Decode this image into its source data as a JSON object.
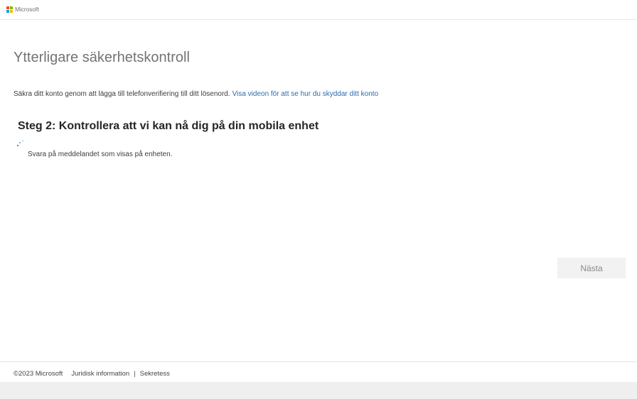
{
  "header": {
    "logo_text": "Microsoft",
    "logo_colors": [
      "#f25022",
      "#7fba00",
      "#00a4ef",
      "#ffb900"
    ]
  },
  "page": {
    "title": "Ytterligare säkerhetskontroll",
    "intro_text": "Säkra ditt konto genom att lägga till telefonverifiering till ditt lösenord.",
    "intro_link": "Visa videon för att se hur du skyddar ditt konto",
    "step_heading": "Steg 2: Kontrollera att vi kan nå dig på din mobila enhet",
    "spinner_icon": "loading-spinner-icon",
    "instruction": "Svara på meddelandet som visas på enheten.",
    "next_button": "Nästa"
  },
  "footer": {
    "copyright": "©2023 Microsoft",
    "legal_link": "Juridisk information",
    "separator": "|",
    "privacy_link": "Sekretess"
  },
  "colors": {
    "link": "#2b6cb0",
    "title": "#737373",
    "button_bg": "#f2f2f2"
  }
}
